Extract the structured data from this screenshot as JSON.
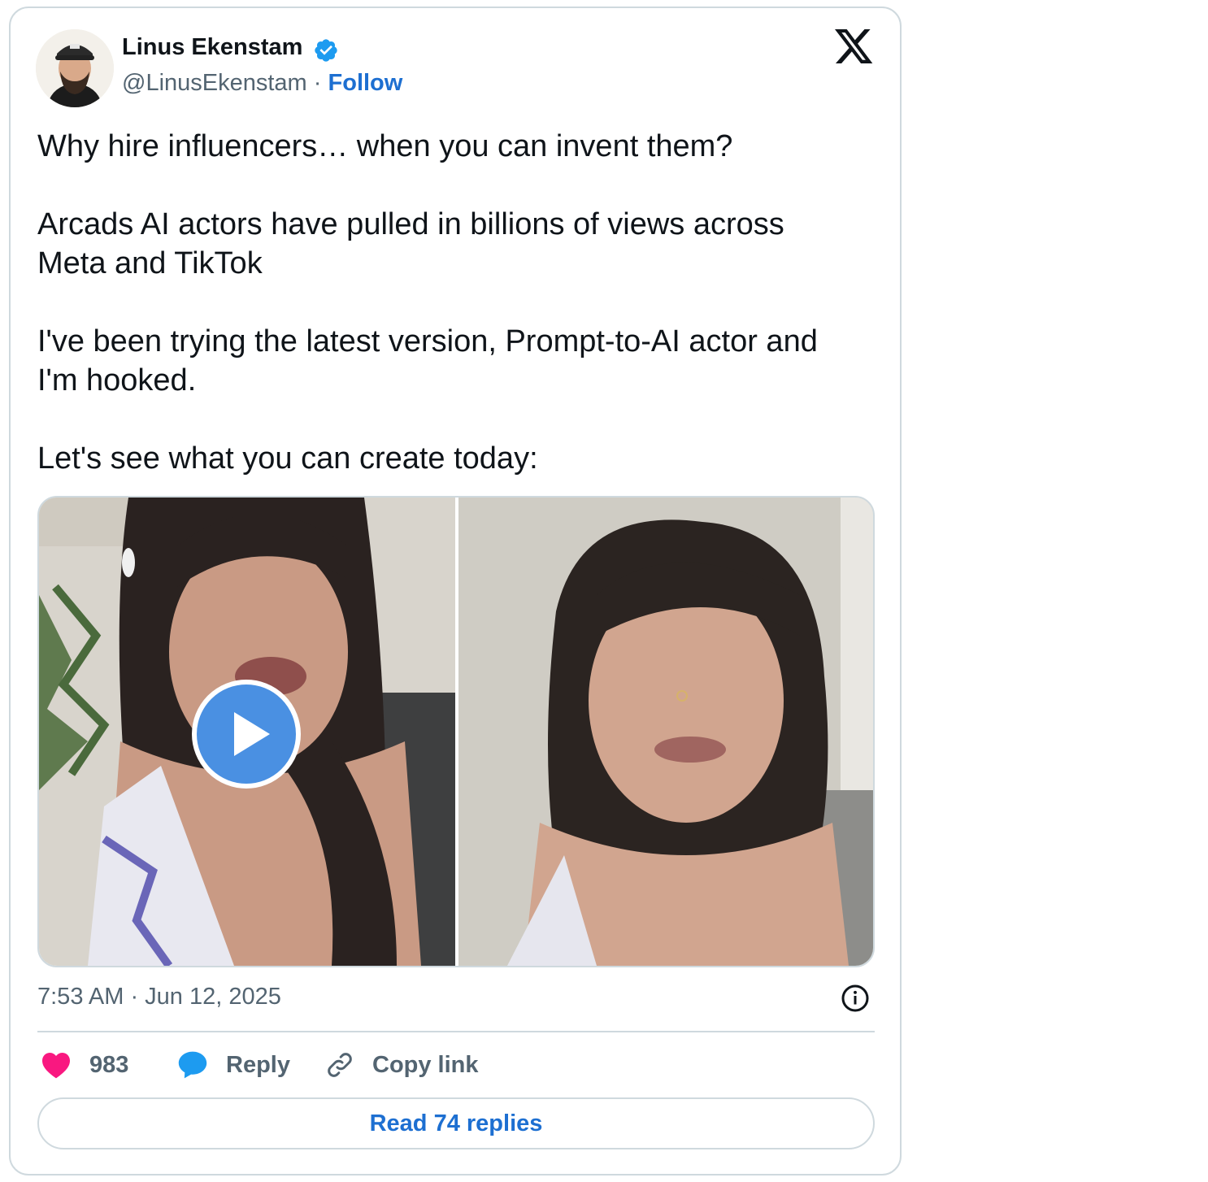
{
  "author": {
    "name": "Linus Ekenstam",
    "handle": "@LinusEkenstam",
    "separator": "·",
    "follow_label": "Follow",
    "verified": true
  },
  "tweet": {
    "paragraphs": [
      "Why hire influencers… when you can invent them?",
      "Arcads AI actors have pulled in billions of views across Meta and TikTok",
      "I've been trying the latest version, Prompt-to-AI actor and I'm hooked.",
      "Let's see what you can create today:"
    ],
    "timestamp": "7:53 AM · Jun 12, 2025"
  },
  "media": {
    "count": 2,
    "first_is_video": true
  },
  "actions": {
    "likes": "983",
    "reply_label": "Reply",
    "copy_link_label": "Copy link"
  },
  "read_replies_label": "Read 74 replies",
  "icons": [
    "x-logo-icon",
    "verified-badge-icon",
    "play-icon",
    "info-icon",
    "heart-icon",
    "reply-bubble-icon",
    "link-icon"
  ],
  "colors": {
    "accent": "#1d6fd1",
    "verified": "#1d9bf0",
    "heart": "#f91880",
    "muted": "#536471",
    "border": "#cfd9de",
    "play": "#4a90e2"
  }
}
